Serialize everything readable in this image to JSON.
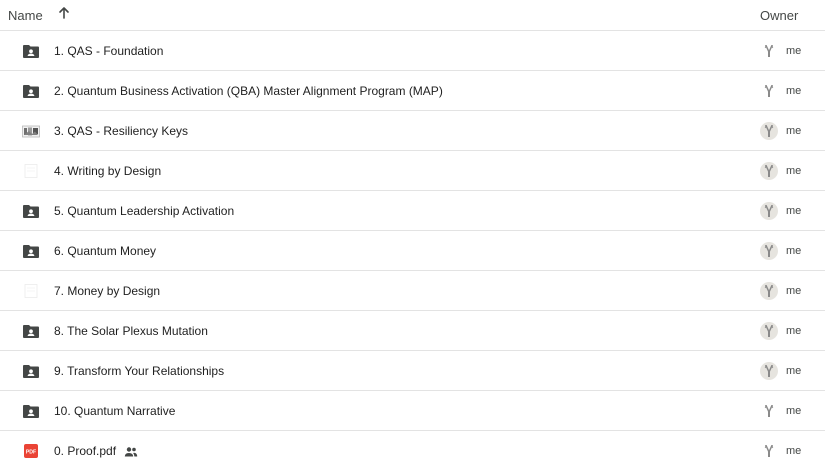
{
  "header": {
    "name_label": "Name",
    "sort_icon": "arrow-up-icon",
    "owner_label": "Owner"
  },
  "colors": {
    "folder": "#444746",
    "pdf": "#ea4335",
    "divider": "#e3e3e3"
  },
  "files": [
    {
      "name": "1. QAS - Foundation",
      "type": "folder",
      "owner": "me"
    },
    {
      "name": "2. Quantum Business Activation (QBA) Master Alignment Program (MAP)",
      "type": "folder",
      "owner": "me"
    },
    {
      "name": "3. QAS - Resiliency Keys",
      "type": "image",
      "owner": "me"
    },
    {
      "name": "4. Writing by Design",
      "type": "doc",
      "owner": "me"
    },
    {
      "name": "5. Quantum Leadership Activation",
      "type": "folder",
      "owner": "me"
    },
    {
      "name": "6. Quantum Money",
      "type": "folder",
      "owner": "me"
    },
    {
      "name": "7. Money by Design",
      "type": "doc",
      "owner": "me"
    },
    {
      "name": "8. The Solar Plexus Mutation",
      "type": "folder",
      "owner": "me"
    },
    {
      "name": "9. Transform Your Relationships",
      "type": "folder",
      "owner": "me"
    },
    {
      "name": "10. Quantum Narrative",
      "type": "folder",
      "owner": "me"
    },
    {
      "name": "0. Proof.pdf",
      "type": "pdf",
      "owner": "me",
      "shared": true,
      "pdf_badge": "PDF"
    }
  ]
}
